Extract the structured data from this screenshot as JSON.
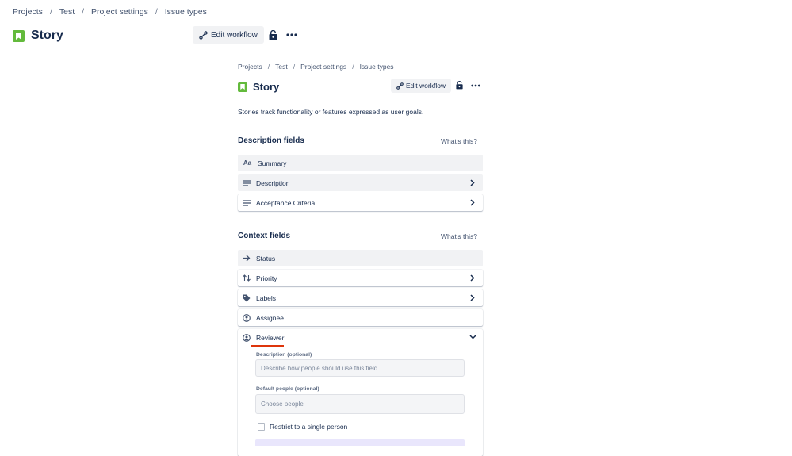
{
  "breadcrumbs": [
    "Projects",
    "Test",
    "Project settings",
    "Issue types"
  ],
  "issue_type": {
    "name": "Story",
    "icon": "bookmark-icon",
    "color": "#63ba3c"
  },
  "toolbar": {
    "edit_workflow": "Edit workflow",
    "lock_icon": "lock-icon",
    "more_icon": "more-icon"
  },
  "description_text": "Stories track functionality or features expressed as user goals.",
  "description_fields": {
    "title": "Description fields",
    "help": "What's this?",
    "items": [
      {
        "label": "Summary",
        "icon": "text-format-icon"
      },
      {
        "label": "Description",
        "icon": "lines-icon"
      },
      {
        "label": "Acceptance Criteria",
        "icon": "lines-icon"
      }
    ]
  },
  "context_fields": {
    "title": "Context fields",
    "help": "What's this?",
    "items": [
      {
        "label": "Status",
        "icon": "arrow-right-icon"
      },
      {
        "label": "Priority",
        "icon": "swap-icon"
      },
      {
        "label": "Labels",
        "icon": "tag-icon"
      },
      {
        "label": "Assignee",
        "icon": "person-icon"
      },
      {
        "label": "Reviewer",
        "icon": "person-icon"
      }
    ]
  },
  "reviewer_panel": {
    "description_label": "Description (optional)",
    "description_placeholder": "Describe how people should use this field",
    "default_people_label": "Default people (optional)",
    "default_people_placeholder": "Choose people",
    "restrict_label": "Restrict to a single person",
    "restrict_checked": false
  },
  "colors": {
    "accent_underline": "#de350b",
    "submit_bar": "#e9e6fc"
  }
}
